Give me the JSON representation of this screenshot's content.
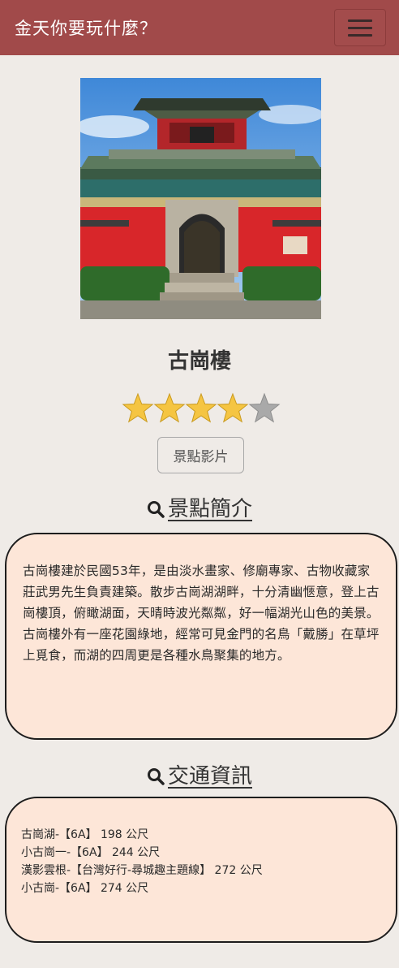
{
  "navbar": {
    "brand": "金天你要玩什麼？",
    "menu_icon": "hamburger-icon"
  },
  "attraction": {
    "name": "古崗樓",
    "rating": 4,
    "rating_max": 5,
    "video_button": "景點影片"
  },
  "intro": {
    "heading": "景點簡介",
    "heading_icon": "search-icon",
    "text": "古崗樓建於民國53年，是由淡水畫家、修廟專家、古物收藏家莊武男先生負責建築。散步古崗湖湖畔，十分清幽愜意，登上古崗樓頂，俯瞰湖面，天晴時波光粼粼，好一幅湖光山色的美景。古崗樓外有一座花園綠地，經常可見金門的名鳥「戴勝」在草坪上覓食，而湖的四周更是各種水鳥聚集的地方。"
  },
  "transport": {
    "heading": "交通資訊",
    "heading_icon": "search-icon",
    "stops": [
      "古崗湖-【6A】 198 公尺",
      "小古崗一-【6A】 244 公尺",
      "漢影雲根-【台灣好行-尋城趣主題線】 272 公尺",
      "小古崗-【6A】 274 公尺"
    ]
  },
  "colors": {
    "navbar": "#a14a4a",
    "box_bg": "#fde6d8",
    "star": "#f5c542",
    "star_empty": "#a9a9a9"
  }
}
